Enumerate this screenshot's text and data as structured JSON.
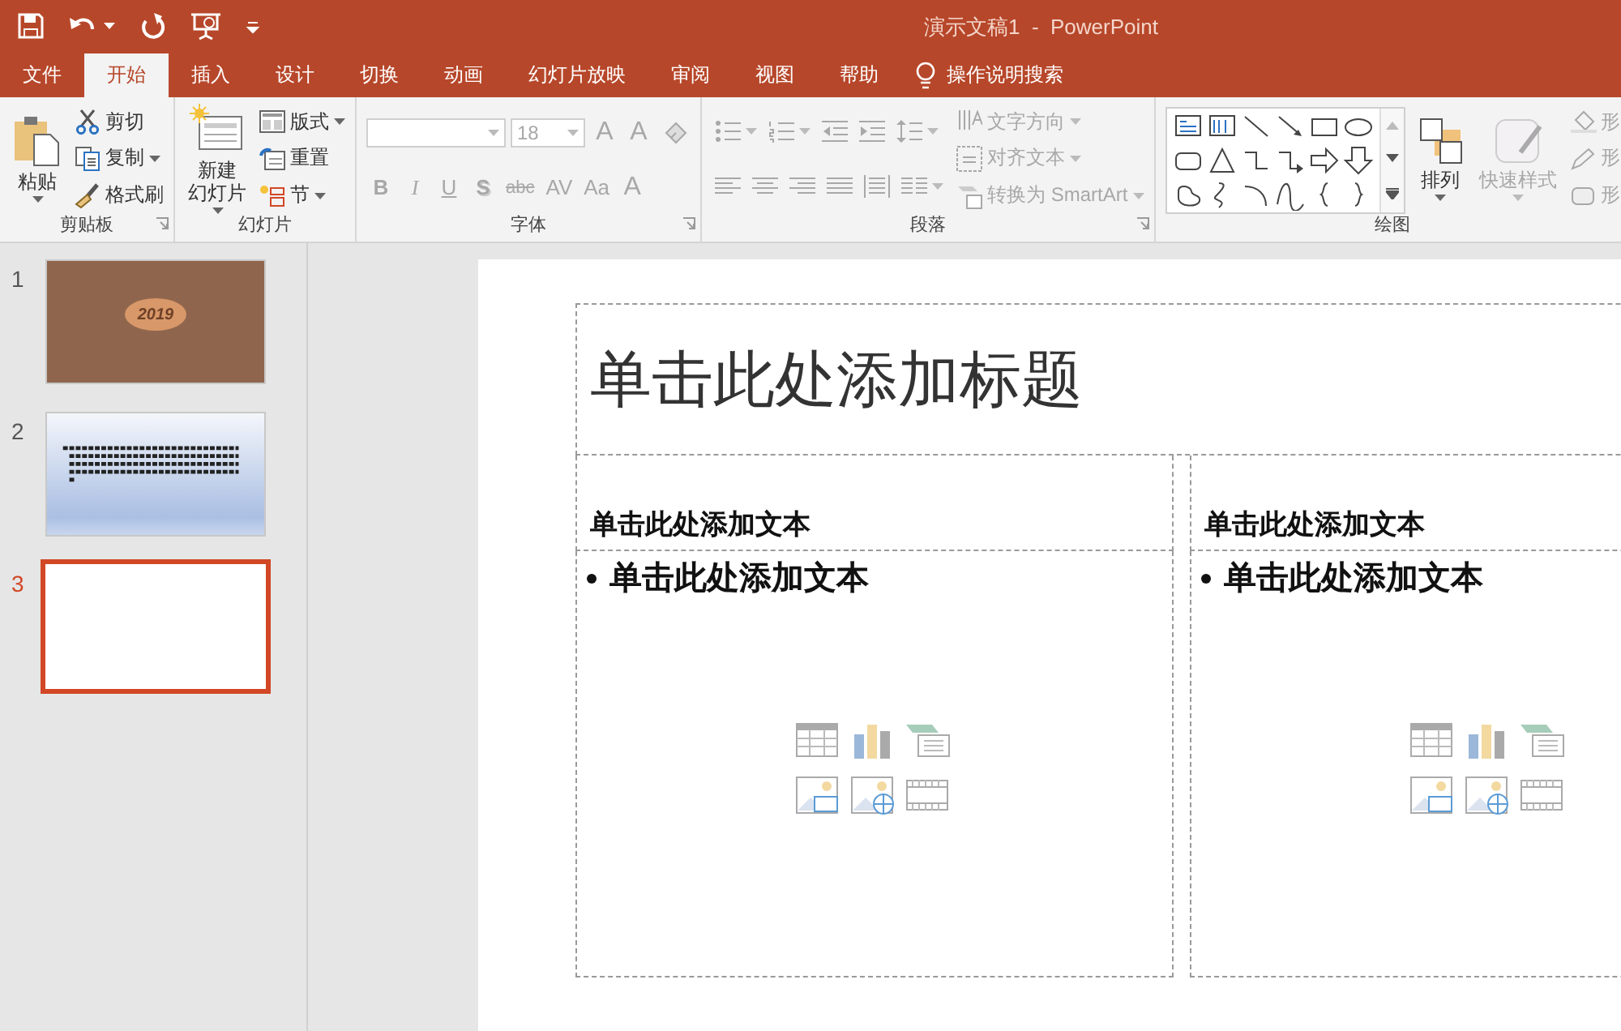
{
  "window": {
    "title": "演示文稿1  -  PowerPoint"
  },
  "tabs": [
    {
      "label": "文件",
      "selected": false
    },
    {
      "label": "开始",
      "selected": true
    },
    {
      "label": "插入",
      "selected": false
    },
    {
      "label": "设计",
      "selected": false
    },
    {
      "label": "切换",
      "selected": false
    },
    {
      "label": "动画",
      "selected": false
    },
    {
      "label": "幻灯片放映",
      "selected": false
    },
    {
      "label": "审阅",
      "selected": false
    },
    {
      "label": "视图",
      "selected": false
    },
    {
      "label": "帮助",
      "selected": false
    }
  ],
  "tell_me": {
    "label": "操作说明搜索"
  },
  "ribbon": [
    {
      "label": "剪贴板",
      "launcher": true,
      "columns": [
        [
          [
            {
              "kind": "big",
              "label": "粘贴",
              "disabled": false
            }
          ]
        ],
        [
          [
            {
              "kind": "small",
              "label": "剪切",
              "disabled": false
            }
          ],
          [
            {
              "kind": "small",
              "label": "复制",
              "disabled": false
            }
          ],
          [
            {
              "kind": "small",
              "label": "格式刷",
              "disabled": false
            }
          ]
        ]
      ]
    },
    {
      "label": "幻灯片",
      "launcher": false,
      "columns": [
        [
          [
            {
              "kind": "big",
              "label": [
                "新建",
                "幻灯片"
              ],
              "disabled": false
            }
          ]
        ],
        [
          [
            {
              "kind": "small",
              "label": "版式",
              "disabled": false
            }
          ],
          [
            {
              "kind": "small",
              "label": "重置",
              "disabled": false
            }
          ],
          [
            {
              "kind": "small",
              "label": "节",
              "disabled": false
            }
          ]
        ]
      ]
    },
    {
      "label": "字体",
      "launcher": true,
      "columns": [
        [
          [
            {
              "kind": "field",
              "disabled": true
            },
            {
              "kind": "field",
              "value": "18",
              "disabled": true
            },
            {
              "kind": "glyph",
              "text": "A",
              "disabled": true
            },
            {
              "kind": "glyph",
              "text": "A",
              "disabled": true
            },
            {
              "kind": "icon",
              "disabled": true
            }
          ],
          [
            {
              "kind": "glyph",
              "text": "B",
              "disabled": true
            },
            {
              "kind": "glyph",
              "text": "I",
              "disabled": true
            },
            {
              "kind": "glyph",
              "text": "U",
              "disabled": true
            },
            {
              "kind": "glyph",
              "text": "S",
              "disabled": true
            },
            {
              "kind": "glyph",
              "text": "abc",
              "disabled": true
            },
            {
              "kind": "glyph",
              "text": "AV",
              "disabled": true
            },
            {
              "kind": "glyph",
              "text": "Aa",
              "disabled": true
            },
            {
              "kind": "glyph",
              "text": "A",
              "disabled": true
            }
          ]
        ]
      ]
    },
    {
      "label": "段落",
      "launcher": true,
      "columns": [
        [
          [
            {
              "kind": "icon",
              "disabled": true
            },
            {
              "kind": "icon",
              "disabled": true
            },
            {
              "kind": "icon",
              "disabled": true
            },
            {
              "kind": "icon",
              "disabled": true
            },
            {
              "kind": "icon",
              "disabled": true
            }
          ],
          [
            {
              "kind": "icon",
              "disabled": true
            },
            {
              "kind": "icon",
              "disabled": true
            },
            {
              "kind": "icon",
              "disabled": true
            },
            {
              "kind": "icon",
              "disabled": true
            },
            {
              "kind": "icon",
              "disabled": true
            },
            {
              "kind": "icon",
              "disabled": true
            }
          ]
        ],
        [
          [
            {
              "kind": "small",
              "label": "文字方向",
              "disabled": true
            }
          ],
          [
            {
              "kind": "small",
              "label": "对齐文本",
              "disabled": true
            }
          ],
          [
            {
              "kind": "small",
              "label": "转换为 SmartArt",
              "disabled": true
            }
          ]
        ]
      ]
    },
    {
      "label": "绘图",
      "launcher": false,
      "columns": [
        [
          [
            {
              "kind": "gallery",
              "disabled": false
            }
          ]
        ],
        [
          [
            {
              "kind": "big",
              "label": "排列",
              "disabled": false
            }
          ]
        ],
        [
          [
            {
              "kind": "big",
              "label": "快速样式",
              "disabled": true
            }
          ]
        ],
        [
          [
            {
              "kind": "small",
              "label": "形",
              "disabled": true
            }
          ],
          [
            {
              "kind": "small",
              "label": "形",
              "disabled": true
            }
          ],
          [
            {
              "kind": "small",
              "label": "形",
              "disabled": true
            }
          ]
        ]
      ]
    }
  ],
  "thumbnails": [
    {
      "number": "1",
      "selected": false,
      "kind": "title",
      "text": "2019"
    },
    {
      "number": "2",
      "selected": false,
      "kind": "text"
    },
    {
      "number": "3",
      "selected": true,
      "kind": "blank"
    }
  ],
  "slide": {
    "title_placeholder": "单击此处添加标题",
    "columns": [
      {
        "heading": "单击此处添加文本",
        "body": "单击此处添加文本"
      },
      {
        "heading": "单击此处添加文本",
        "body": "单击此处添加文本"
      }
    ]
  }
}
